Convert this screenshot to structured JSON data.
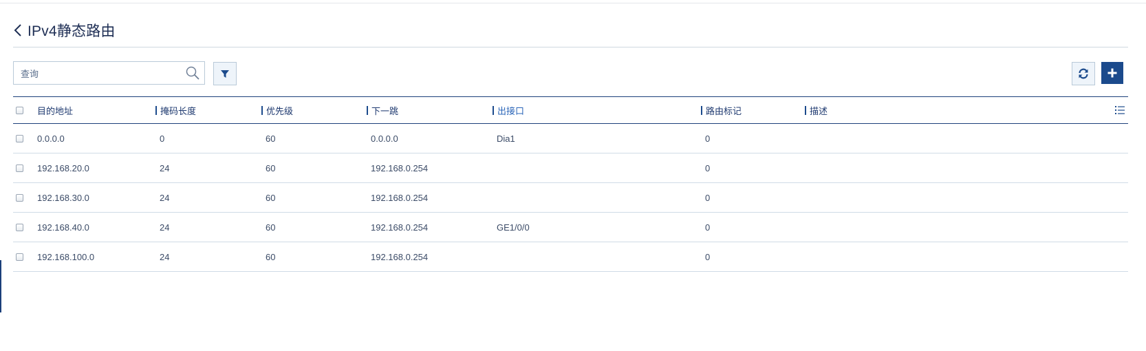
{
  "header": {
    "title": "IPv4静态路由"
  },
  "search": {
    "placeholder": "查询",
    "value": ""
  },
  "icons": {
    "back": "chevron-left-icon",
    "search": "magnifier-icon",
    "filter": "funnel-icon",
    "refresh": "refresh-icon",
    "add": "plus-icon",
    "column_menu": "list-icon"
  },
  "colors": {
    "accent": "#1b4a8c",
    "border": "#b9c9d8",
    "link": "#2a65b8"
  },
  "table": {
    "columns": [
      {
        "key": "dest",
        "label": "目的地址"
      },
      {
        "key": "mask",
        "label": "掩码长度"
      },
      {
        "key": "priority",
        "label": "优先级"
      },
      {
        "key": "nexthop",
        "label": "下一跳"
      },
      {
        "key": "iface",
        "label": "出接口"
      },
      {
        "key": "tag",
        "label": "路由标记"
      },
      {
        "key": "desc",
        "label": "描述"
      }
    ],
    "rows": [
      {
        "dest": "0.0.0.0",
        "mask": "0",
        "priority": "60",
        "nexthop": "0.0.0.0",
        "iface": "Dia1",
        "tag": "0",
        "desc": ""
      },
      {
        "dest": "192.168.20.0",
        "mask": "24",
        "priority": "60",
        "nexthop": "192.168.0.254",
        "iface": "",
        "tag": "0",
        "desc": ""
      },
      {
        "dest": "192.168.30.0",
        "mask": "24",
        "priority": "60",
        "nexthop": "192.168.0.254",
        "iface": "",
        "tag": "0",
        "desc": ""
      },
      {
        "dest": "192.168.40.0",
        "mask": "24",
        "priority": "60",
        "nexthop": "192.168.0.254",
        "iface": "GE1/0/0",
        "tag": "0",
        "desc": ""
      },
      {
        "dest": "192.168.100.0",
        "mask": "24",
        "priority": "60",
        "nexthop": "192.168.0.254",
        "iface": "",
        "tag": "0",
        "desc": ""
      }
    ]
  }
}
